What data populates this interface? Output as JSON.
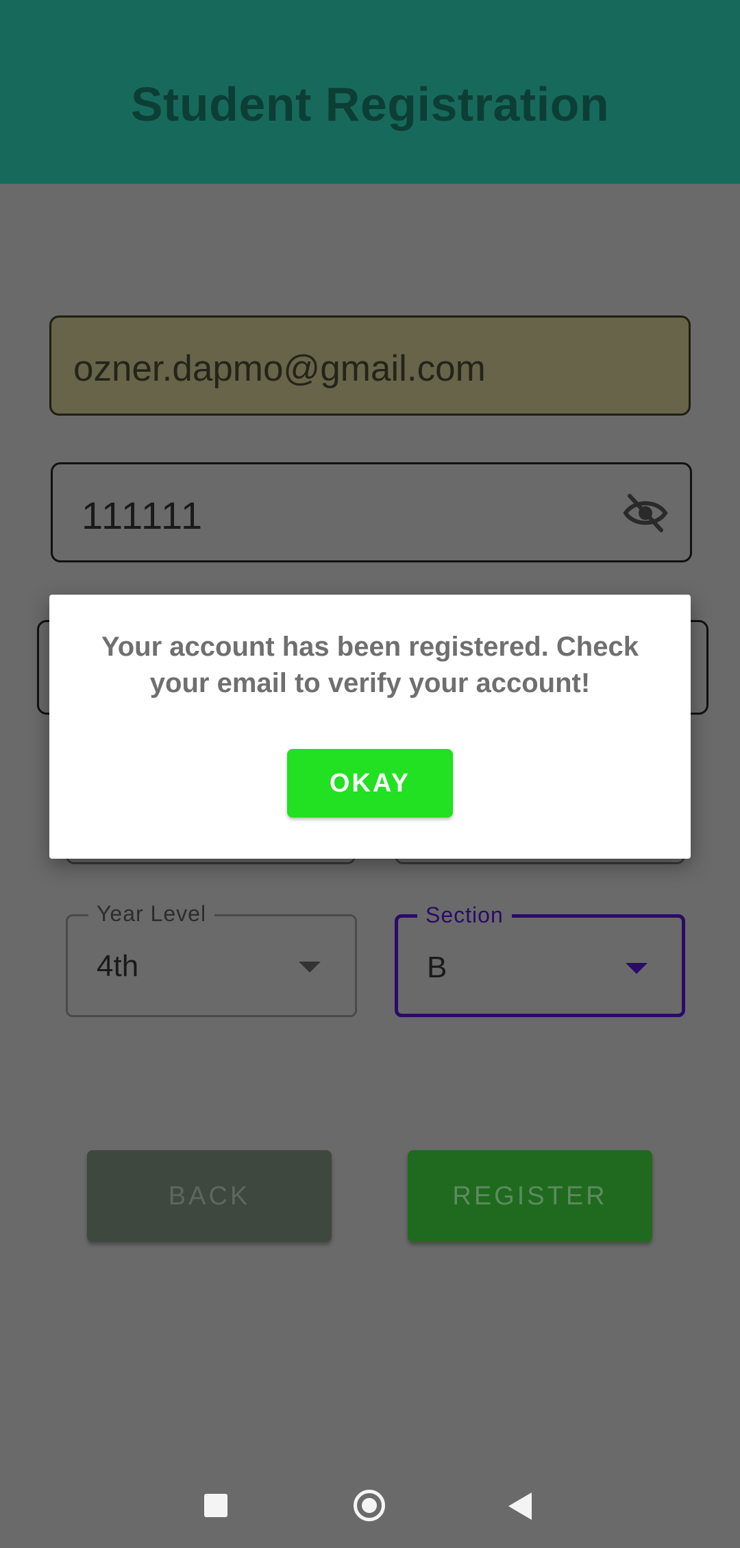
{
  "appbar": {
    "title": "Student Registration"
  },
  "form": {
    "email_value": "ozner.dapmo@gmail.com",
    "password_value": "111111",
    "year_level": {
      "label": "Year Level",
      "value": "4th"
    },
    "section": {
      "label": "Section",
      "value": "B"
    }
  },
  "buttons": {
    "back_label": "BACK",
    "register_label": "REGISTER"
  },
  "dialog": {
    "message": "Your account has been registered. Check your email to verify your account!",
    "okay_label": "OKAY"
  },
  "colors": {
    "appbar": "#176a5b",
    "okay_button": "#22e022",
    "section_accent": "#2a0a6a",
    "register_button": "#1f6a1f"
  },
  "icons": {
    "password_toggle": "eye-off-icon",
    "nav_recents": "square-icon",
    "nav_home": "circle-icon",
    "nav_back": "triangle-back-icon"
  }
}
